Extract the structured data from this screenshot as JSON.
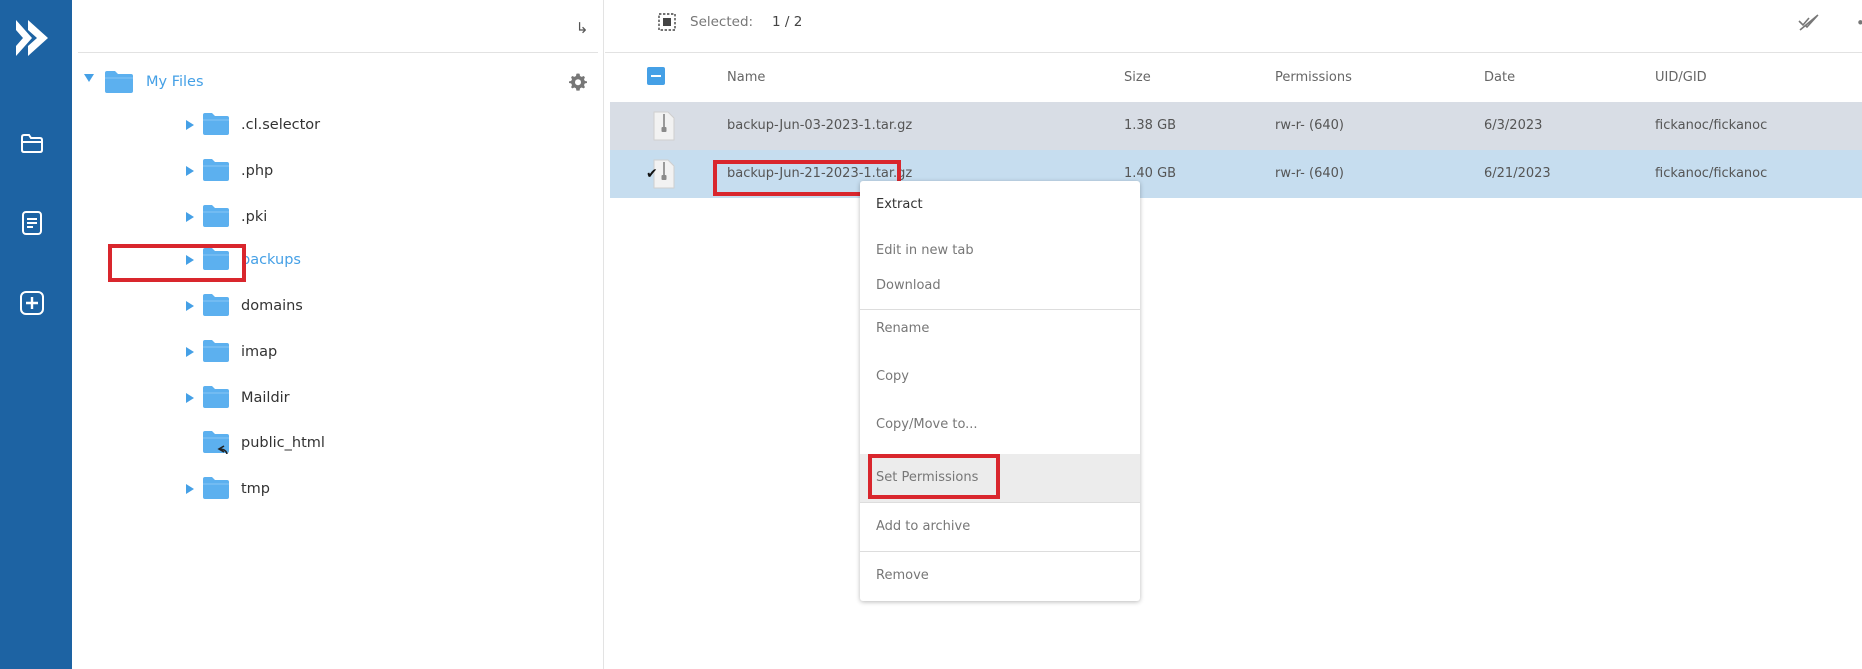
{
  "colors": {
    "rail": "#1d63a3",
    "accent": "#45a0e6",
    "highlight": "#d9262d",
    "row_selected": "#c6ddef",
    "row_alt": "#d8dde5"
  },
  "rail": {
    "icons": [
      "app-logo-icon",
      "folder-nav-icon",
      "document-nav-icon",
      "add-nav-icon"
    ]
  },
  "tree": {
    "root_label": "My Files",
    "items": [
      {
        "label": ".cl.selector",
        "expandable": true
      },
      {
        "label": ".php",
        "expandable": true
      },
      {
        "label": ".pki",
        "expandable": true
      },
      {
        "label": "backups",
        "expandable": true,
        "active": true
      },
      {
        "label": "domains",
        "expandable": true
      },
      {
        "label": "imap",
        "expandable": true
      },
      {
        "label": "Maildir",
        "expandable": true
      },
      {
        "label": "public_html",
        "expandable": false,
        "symlink": true
      },
      {
        "label": "tmp",
        "expandable": true
      }
    ]
  },
  "toolbar": {
    "selected_label": "Selected:",
    "selected_count": "1 / 2"
  },
  "table": {
    "columns": [
      "Name",
      "Size",
      "Permissions",
      "Date",
      "UID/GID"
    ],
    "rows": [
      {
        "name": "backup-Jun-03-2023-1.tar.gz",
        "size": "1.38 GB",
        "permissions": "rw-r- (640)",
        "date": "6/3/2023",
        "uid": "fickanoc/fickanoc",
        "checked": false
      },
      {
        "name": "backup-Jun-21-2023-1.tar.gz",
        "size": "1.40 GB",
        "permissions": "rw-r- (640)",
        "date": "6/21/2023",
        "uid": "fickanoc/fickanoc",
        "checked": true
      }
    ]
  },
  "context_menu": {
    "items": [
      {
        "label": "Extract"
      },
      {
        "label": "Edit in new tab"
      },
      {
        "label": "Download"
      },
      {
        "label": "Rename"
      },
      {
        "label": "Copy"
      },
      {
        "label": "Copy/Move to..."
      },
      {
        "label": "Set Permissions",
        "hovered": true
      },
      {
        "label": "Add to archive"
      },
      {
        "label": "Remove"
      }
    ]
  }
}
